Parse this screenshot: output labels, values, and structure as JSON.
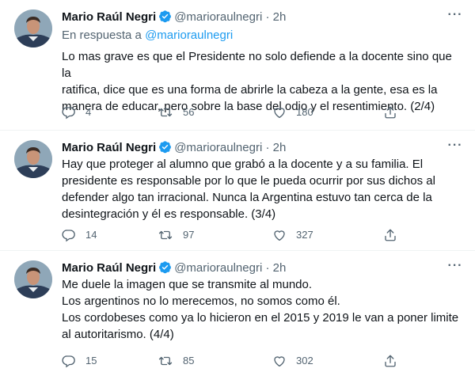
{
  "tweets": [
    {
      "name": "Mario Raúl Negri",
      "handle": "@marioraulnegri",
      "dot": "·",
      "time": "2h",
      "reply_prefix": "En respuesta a",
      "reply_handle": "@marioraulnegri",
      "text": "Lo mas grave es que el Presidente no solo defiende a la docente sino que la\nratifica, dice que es una forma de abrirle la cabeza a la gente, esa es la\nmanera de educar, pero sobre la base del odio y el resentimiento. (2/4)",
      "replies": "4",
      "retweets": "56",
      "likes": "180"
    },
    {
      "name": "Mario Raúl Negri",
      "handle": "@marioraulnegri",
      "dot": "·",
      "time": "2h",
      "text": "Hay que proteger al alumno que grabó a la docente y a su familia. El\npresidente es responsable por lo que le pueda ocurrir por sus dichos al\ndefender algo tan irracional. Nunca la Argentina estuvo tan cerca de la\ndesintegración y él es responsable. (3/4)",
      "replies": "14",
      "retweets": "97",
      "likes": "327"
    },
    {
      "name": "Mario Raúl Negri",
      "handle": "@marioraulnegri",
      "dot": "·",
      "time": "2h",
      "text": "Me duele la imagen que se transmite al mundo.\nLos argentinos no lo merecemos, no somos como él.\nLos cordobeses como ya lo hicieron en el 2015 y 2019 le van a poner limite\nal autoritarismo. (4/4)",
      "replies": "15",
      "retweets": "85",
      "likes": "302"
    }
  ],
  "icons": {
    "more": "more-dots-icon",
    "verified": "verified-badge-icon",
    "reply": "reply-icon",
    "retweet": "retweet-icon",
    "like": "heart-icon",
    "share": "share-icon"
  },
  "colors": {
    "accent": "#1d9bf0",
    "secondary_text": "#536471",
    "primary_text": "#0f1419"
  }
}
